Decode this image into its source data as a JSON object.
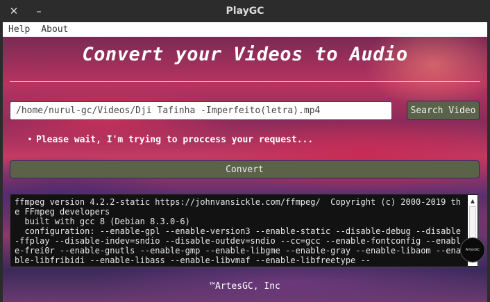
{
  "window": {
    "title": "PlayGC",
    "close_glyph": "✕",
    "minimize_glyph": "–"
  },
  "menu": {
    "items": [
      "Help",
      "About"
    ]
  },
  "main": {
    "heading": "Convert your Videos to Audio",
    "path_value": "/home/nurul-gc/Videos/Dji Tafinha -Imperfeito(letra).mp4",
    "search_label": "Search Video",
    "status_bullet": "•",
    "status_text": "Please wait, I'm trying to proccess your request...",
    "convert_label": "Convert",
    "log_text": "ffmpeg version 4.2.2-static https://johnvansickle.com/ffmpeg/  Copyright (c) 2000-2019 the FFmpeg developers\n  built with gcc 8 (Debian 8.3.0-6)\n  configuration: --enable-gpl --enable-version3 --enable-static --disable-debug --disable-ffplay --disable-indev=sndio --disable-outdev=sndio --cc=gcc --enable-fontconfig --enable-frei0r --enable-gnutls --enable-gmp --enable-libgme --enable-gray --enable-libaom --enable-libfribidi --enable-libass --enable-libvmaf --enable-libfreetype --",
    "scroll_up": "▲",
    "scroll_down": "▼",
    "footer": "™ArtesGC, Inc",
    "badge_text": "ArtesGC"
  },
  "colors": {
    "button_bg": "#5a6248",
    "titlebar_bg": "#2c2c2c",
    "log_bg": "#121212"
  },
  "icons": [
    "close-icon",
    "minimize-icon",
    "scroll-up-icon",
    "scroll-down-icon",
    "logo-badge"
  ]
}
